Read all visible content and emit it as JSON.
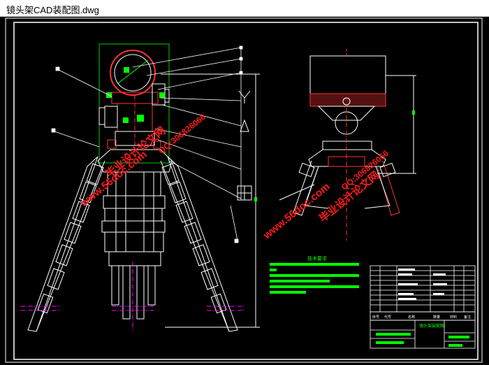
{
  "window": {
    "title": "镜头架CAD装配图.dwg"
  },
  "drawing": {
    "watermark_url": "www.56doc.com",
    "watermark_name": "毕业设计论文网",
    "watermark_qq": "QQ:306826066",
    "tech_req_title": "技术要求",
    "title_block": {
      "part_name": "镜头架装配图",
      "header_row": [
        "序号",
        "代号",
        "名称",
        "数量",
        "材料",
        "备注"
      ]
    }
  },
  "colors": {
    "background": "#000000",
    "line": "#ffffff",
    "accent_green": "#00ff00",
    "accent_red": "#ff1a1a",
    "centerline_magenta": "#ff00ff"
  }
}
